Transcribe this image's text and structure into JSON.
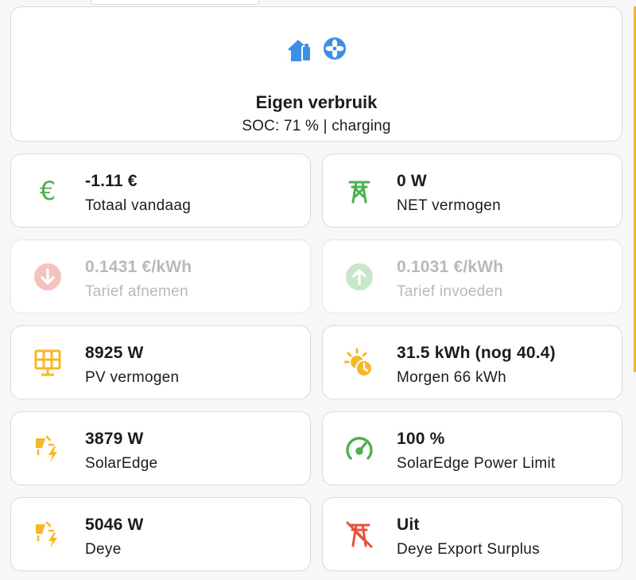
{
  "header": {
    "title": "Eigen verbruik",
    "subtitle": "SOC: 71 % | charging",
    "icons": [
      "home-battery-icon",
      "fan-icon"
    ],
    "icon_color": "#3d8fe6"
  },
  "tiles": [
    {
      "value": "-1.11 €",
      "label": "Totaal vandaag",
      "icon": "euro-icon",
      "color": "#4caf50",
      "disabled": false
    },
    {
      "value": "0 W",
      "label": "NET vermogen",
      "icon": "transmission-tower-icon",
      "color": "#4caf50",
      "disabled": false
    },
    {
      "value": "0.1431 €/kWh",
      "label": "Tarief afnemen",
      "icon": "arrow-down-circle-icon",
      "color": "#f4c3c0",
      "disabled": true
    },
    {
      "value": "0.1031 €/kWh",
      "label": "Tarief invoeden",
      "icon": "arrow-up-circle-icon",
      "color": "#c8e6c9",
      "disabled": true
    },
    {
      "value": "8925 W",
      "label": "PV vermogen",
      "icon": "solar-panel-icon",
      "color": "#f4b928",
      "disabled": false
    },
    {
      "value": "31.5 kWh (nog 40.4)",
      "label": "Morgen 66 kWh",
      "icon": "sun-clock-icon",
      "color": "#f4b928",
      "disabled": false
    },
    {
      "value": "3879 W",
      "label": "SolarEdge",
      "icon": "solar-power-icon",
      "color": "#f4b928",
      "disabled": false
    },
    {
      "value": "100 %",
      "label": "SolarEdge Power Limit",
      "icon": "gauge-icon",
      "color": "#4caf50",
      "disabled": false
    },
    {
      "value": "5046 W",
      "label": "Deye",
      "icon": "solar-power-icon",
      "color": "#f4b928",
      "disabled": false
    },
    {
      "value": "Uit",
      "label": "Deye Export Surplus",
      "icon": "transmission-tower-off-icon",
      "color": "#e5533d",
      "disabled": false
    }
  ]
}
